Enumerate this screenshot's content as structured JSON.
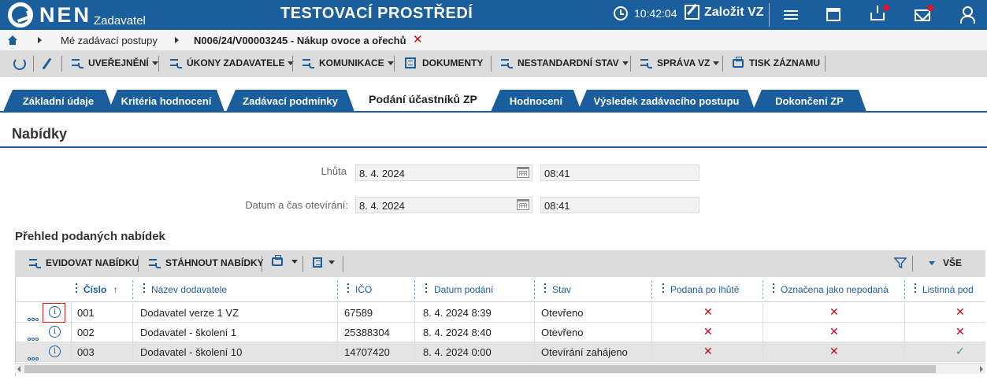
{
  "header": {
    "logo": "NEN",
    "logo_sub": "Zadavatel",
    "env_title": "TESTOVACÍ PROSTŘEDÍ",
    "time": "10:42:04",
    "create_label": "Založit VZ"
  },
  "breadcrumb": {
    "item1": "Mé zadávací postupy",
    "item2": "N006/24/V00003245 - Nákup ovoce a ořechů",
    "close": "✕"
  },
  "toolbar": {
    "uverejneni": "UVEŘEJNĚNÍ",
    "ukony": "ÚKONY ZADAVATELE",
    "komunikace": "KOMUNIKACE",
    "dokumenty": "DOKUMENTY",
    "nestandardni": "NESTANDARDNÍ STAV",
    "sprava": "SPRÁVA VZ",
    "tisk": "TISK ZÁZNAMU"
  },
  "tabs": [
    "Základní údaje",
    "Kritéria hodnocení",
    "Zadávací podmínky",
    "Podání účastníků ZP",
    "Hodnocení",
    "Výsledek zadávacího postupu",
    "Dokončení ZP"
  ],
  "section": {
    "title": "Nabídky",
    "lhuta_label": "Lhůta",
    "lhuta_date": "8. 4. 2024",
    "lhuta_time": "08:41",
    "open_label": "Datum a čas otevírání:",
    "open_date": "8. 4. 2024",
    "open_time": "08:41"
  },
  "grid": {
    "title": "Přehled podaných nabídek",
    "evidovat": "EVIDOVAT NABÍDKU",
    "stahnout": "STÁHNOUT NABÍDKY",
    "vse": "VŠE",
    "columns": {
      "cislo": "Číslo",
      "sort": "↑",
      "nazev": "Název dodavatele",
      "ico": "IČO",
      "datum": "Datum podání",
      "stav": "Stav",
      "po_lhute": "Podaná po lhůtě",
      "nepodana": "Označena jako nepodaná",
      "listinna": "Listinná pod"
    },
    "rows": [
      {
        "cislo": "001",
        "nazev": "Dodavatel verze 1 VZ",
        "ico": "67589",
        "datum": "8. 4. 2024 8:39",
        "stav": "Otevřeno",
        "po_lhute": "✕",
        "nepodana": "✕",
        "listinna": "✕"
      },
      {
        "cislo": "002",
        "nazev": "Dodavatel - školení 1",
        "ico": "25388304",
        "datum": "8. 4. 2024 8:40",
        "stav": "Otevřeno",
        "po_lhute": "✕",
        "nepodana": "✕",
        "listinna": "✕"
      },
      {
        "cislo": "003",
        "nazev": "Dodavatel - školení 10",
        "ico": "14707420",
        "datum": "8. 4. 2024 0:00",
        "stav": "Otevírání zahájeno",
        "po_lhute": "✕",
        "nepodana": "✕",
        "listinna": "✓"
      }
    ]
  },
  "colors": {
    "brand": "#1b5e9e",
    "alert": "#e0142a",
    "ok": "#3aa14a"
  }
}
